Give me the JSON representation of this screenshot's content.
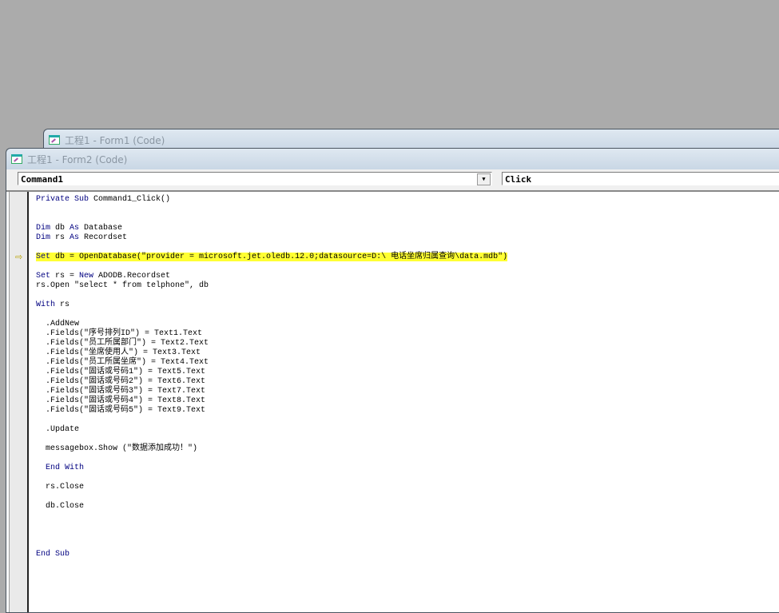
{
  "windows": {
    "form1_title": "工程1 - Form1 (Code)",
    "form2_title": "工程1 - Form2 (Code)"
  },
  "combos": {
    "object": "Command1",
    "procedure": "Click"
  },
  "code_lines": [
    [
      [
        "Private Sub ",
        1
      ],
      [
        "Command1_Click()",
        0
      ]
    ],
    [],
    [],
    [
      [
        "Dim ",
        1
      ],
      [
        "db ",
        0
      ],
      [
        "As ",
        1
      ],
      [
        "Database",
        0
      ]
    ],
    [
      [
        "Dim ",
        1
      ],
      [
        "rs ",
        0
      ],
      [
        "As ",
        1
      ],
      [
        "Recordset",
        0
      ]
    ],
    [],
    [
      [
        "Set ",
        1
      ],
      [
        "db = OpenDatabase(\"provider = microsoft.jet.oledb.12.0;datasource=D:\\ 电话坐席归属查询\\data.mdb\")",
        0
      ]
    ],
    [],
    [
      [
        "Set ",
        1
      ],
      [
        "rs = ",
        0
      ],
      [
        "New ",
        1
      ],
      [
        "ADODB.Recordset",
        0
      ]
    ],
    [
      [
        "rs.Open \"select * from telphone\", db",
        0
      ]
    ],
    [],
    [
      [
        "With ",
        1
      ],
      [
        "rs",
        0
      ]
    ],
    [],
    [
      [
        "  .AddNew",
        0
      ]
    ],
    [
      [
        "  .Fields(\"序号排列ID\") = Text1.Text",
        0
      ]
    ],
    [
      [
        "  .Fields(\"员工所属部门\") = Text2.Text",
        0
      ]
    ],
    [
      [
        "  .Fields(\"坐席使用人\") = Text3.Text",
        0
      ]
    ],
    [
      [
        "  .Fields(\"员工所属坐席\") = Text4.Text",
        0
      ]
    ],
    [
      [
        "  .Fields(\"固话或号码1\") = Text5.Text",
        0
      ]
    ],
    [
      [
        "  .Fields(\"固话或号码2\") = Text6.Text",
        0
      ]
    ],
    [
      [
        "  .Fields(\"固话或号码3\") = Text7.Text",
        0
      ]
    ],
    [
      [
        "  .Fields(\"固话或号码4\") = Text8.Text",
        0
      ]
    ],
    [
      [
        "  .Fields(\"固话或号码5\") = Text9.Text",
        0
      ]
    ],
    [],
    [
      [
        "  .Update",
        0
      ]
    ],
    [],
    [
      [
        "  messagebox.Show (\"数据添加成功！\")",
        0
      ]
    ],
    [],
    [
      [
        "  ",
        0
      ],
      [
        "End With",
        1
      ]
    ],
    [],
    [
      [
        "  rs.Close",
        0
      ]
    ],
    [],
    [
      [
        "  db.Close",
        0
      ]
    ],
    [],
    [],
    [],
    [],
    [
      [
        "End Sub",
        1
      ]
    ]
  ],
  "current_line": 6,
  "colors": {
    "highlight": "#ffff33",
    "keyword": "#000080"
  }
}
